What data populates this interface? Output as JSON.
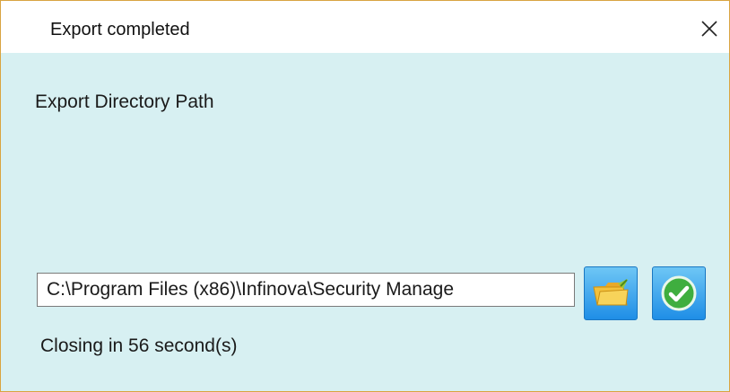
{
  "window": {
    "title": "Export completed"
  },
  "main": {
    "section_label": "Export Directory Path",
    "path_value": "C:\\Program Files (x86)\\Infinova\\Security Manage",
    "status_text": "Closing in 56 second(s)"
  },
  "icons": {
    "close": "close-icon",
    "browse": "folder-icon",
    "confirm": "check-circle-icon"
  },
  "colors": {
    "content_background": "#d7f0f2",
    "window_border": "#d9a441",
    "button_blue": "#1f8ee6",
    "confirm_green": "#3fae3f",
    "folder_yellow": "#f2c13c"
  }
}
